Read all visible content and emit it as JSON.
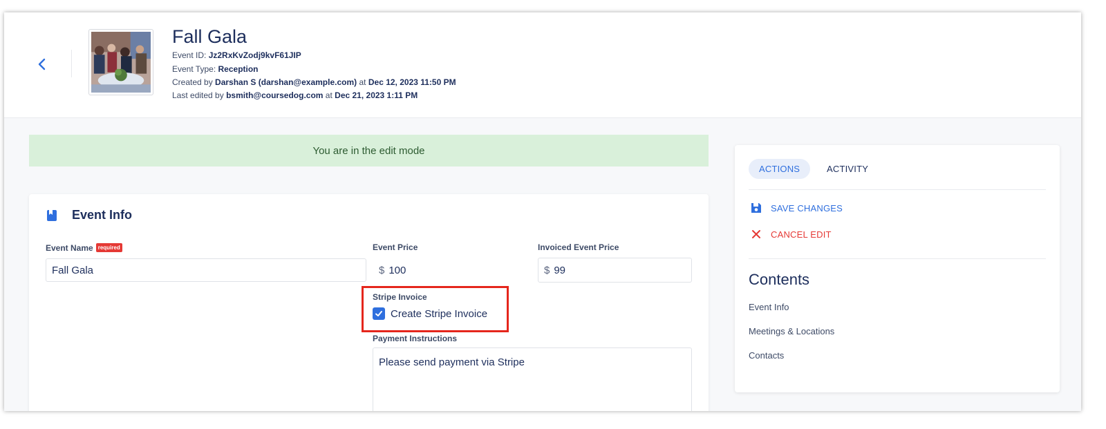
{
  "header": {
    "title": "Fall Gala",
    "event_id_label": "Event ID:",
    "event_id": "Jz2RxKvZodj9kvF61JIP",
    "event_type_label": "Event Type:",
    "event_type": "Reception",
    "created_prefix": "Created by",
    "created_by": "Darshan S (darshan@example.com)",
    "created_at_word": "at",
    "created_at": "Dec 12, 2023 11:50 PM",
    "edited_prefix": "Last edited by",
    "edited_by": "bsmith@coursedog.com",
    "edited_at_word": "at",
    "edited_at": "Dec 21, 2023 1:11 PM"
  },
  "banner": {
    "text": "You are in the edit mode"
  },
  "event_info": {
    "title": "Event Info",
    "event_name_label": "Event Name",
    "required_badge": "required",
    "event_name_value": "Fall Gala",
    "event_price_label": "Event Price",
    "event_price_currency": "$",
    "event_price_value": "100",
    "invoiced_price_label": "Invoiced Event Price",
    "invoiced_price_currency": "$",
    "invoiced_price_value": "99",
    "stripe_label": "Stripe Invoice",
    "stripe_checkbox_label": "Create Stripe Invoice",
    "stripe_checked": true,
    "payment_label": "Payment Instructions",
    "payment_value": "Please send payment via Stripe"
  },
  "side_panel": {
    "tabs": [
      {
        "label": "ACTIONS",
        "active": true
      },
      {
        "label": "ACTIVITY",
        "active": false
      }
    ],
    "actions": {
      "save_label": "SAVE CHANGES",
      "cancel_label": "CANCEL EDIT"
    },
    "contents_title": "Contents",
    "contents_links": [
      "Event Info",
      "Meetings & Locations",
      "Contacts"
    ]
  },
  "icons": {
    "back": "chevron-left-icon",
    "event_info": "book-icon",
    "save": "floppy-disk-icon",
    "cancel": "close-icon",
    "checkbox": "checkmark-icon"
  },
  "colors": {
    "accent": "#2f6fde",
    "danger": "#e53935",
    "banner_bg": "#d9f0da",
    "banner_text": "#2d5b31",
    "title_text": "#1d2e5c"
  }
}
